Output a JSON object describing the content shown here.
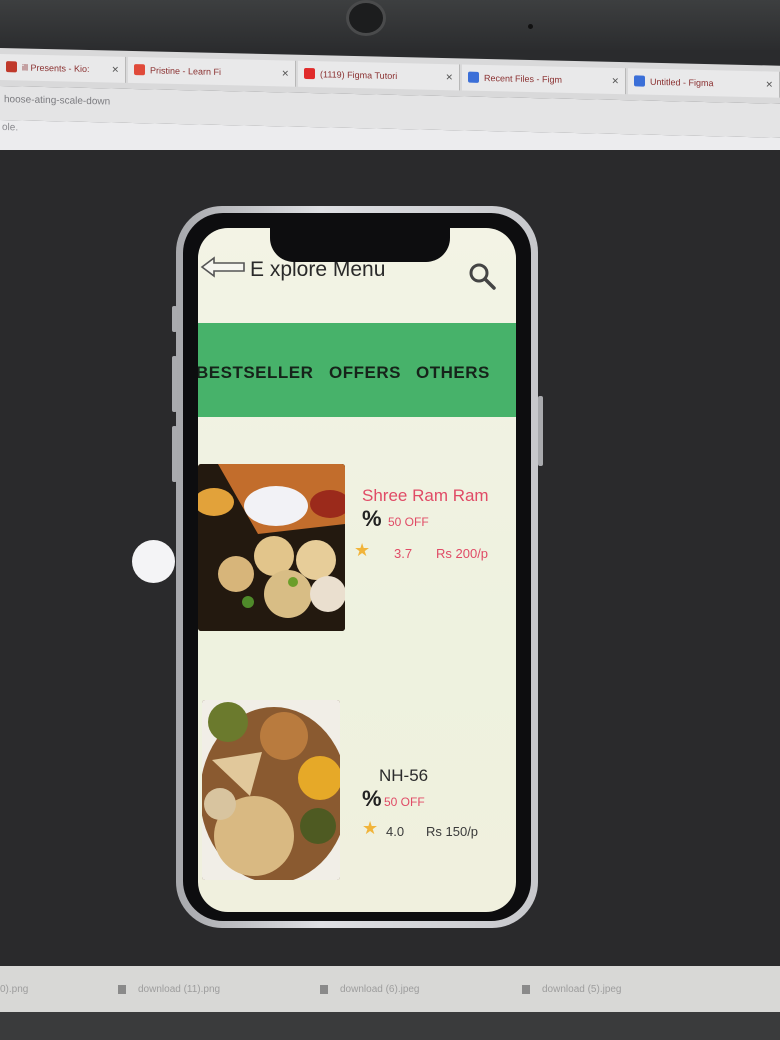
{
  "browser": {
    "tabs": [
      {
        "label": "ill Presents - Kio:",
        "color": "#c0392b"
      },
      {
        "label": "Pristine - Learn Fi",
        "color": "#e04a3a"
      },
      {
        "label": "(1119) Figma Tutori",
        "color": "#e02b2b"
      },
      {
        "label": "Recent Files - Figm",
        "color": "#3b6fd8"
      },
      {
        "label": "Untitled - Figma",
        "color": "#3b6fd8"
      }
    ],
    "address_text": "hoose-ating-scale-down",
    "bookmark_text": "ole."
  },
  "app": {
    "title": "E xplore Menu",
    "categories": [
      "BESTSELLER",
      "OFFERS",
      "OTHERS"
    ],
    "category_color": "#47b26a",
    "items": [
      {
        "name": "Shree Ram Ram",
        "offer": "50 OFF",
        "rating": "3.7",
        "price": "Rs 200/p"
      },
      {
        "name": "NH-56",
        "offer": "50 OFF",
        "rating": "4.0",
        "price": "Rs 150/p"
      }
    ],
    "accent_color": "#e04b66",
    "star_color": "#f1b43a"
  },
  "downloads": [
    {
      "label": "0).png"
    },
    {
      "label": "download (11).png"
    },
    {
      "label": "download (6).jpeg"
    },
    {
      "label": "download (5).jpeg"
    }
  ]
}
